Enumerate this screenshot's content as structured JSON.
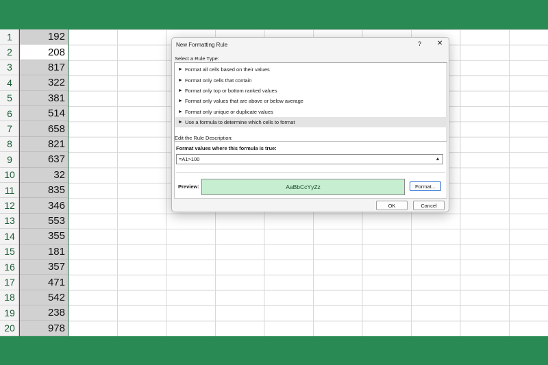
{
  "sheet": {
    "rows": [
      {
        "num": "1",
        "value": "192"
      },
      {
        "num": "2",
        "value": "208"
      },
      {
        "num": "3",
        "value": "817"
      },
      {
        "num": "4",
        "value": "322"
      },
      {
        "num": "5",
        "value": "381"
      },
      {
        "num": "6",
        "value": "514"
      },
      {
        "num": "7",
        "value": "658"
      },
      {
        "num": "8",
        "value": "821"
      },
      {
        "num": "9",
        "value": "637"
      },
      {
        "num": "10",
        "value": "32"
      },
      {
        "num": "11",
        "value": "835"
      },
      {
        "num": "12",
        "value": "346"
      },
      {
        "num": "13",
        "value": "553"
      },
      {
        "num": "14",
        "value": "355"
      },
      {
        "num": "15",
        "value": "181"
      },
      {
        "num": "16",
        "value": "357"
      },
      {
        "num": "17",
        "value": "471"
      },
      {
        "num": "18",
        "value": "542"
      },
      {
        "num": "19",
        "value": "238"
      },
      {
        "num": "20",
        "value": "978"
      }
    ],
    "active_row": "2"
  },
  "dialog": {
    "title": "New Formatting Rule",
    "help_label": "?",
    "close_label": "✕",
    "select_rule_label": "Select a Rule Type:",
    "rule_types": [
      "Format all cells based on their values",
      "Format only cells that contain",
      "Format only top or bottom ranked values",
      "Format only values that are above or below average",
      "Format only unique or duplicate values",
      "Use a formula to determine which cells to format"
    ],
    "selected_rule_index": 5,
    "rule_arrow": "►",
    "edit_label": "Edit the Rule Description:",
    "formula_label": "Format values where this formula is true:",
    "formula_value": "=A1>100",
    "collapse_icon": "collapse-dialog-icon",
    "collapse_glyph": "⯅",
    "preview_label": "Preview:",
    "preview_text": "AaBbCcYyZz",
    "preview_fill": "#c7eed0",
    "format_button": "Format...",
    "ok_button": "OK",
    "cancel_button": "Cancel"
  },
  "colors": {
    "accent_green": "#2a8a53",
    "selection_border": "#1e7145"
  }
}
